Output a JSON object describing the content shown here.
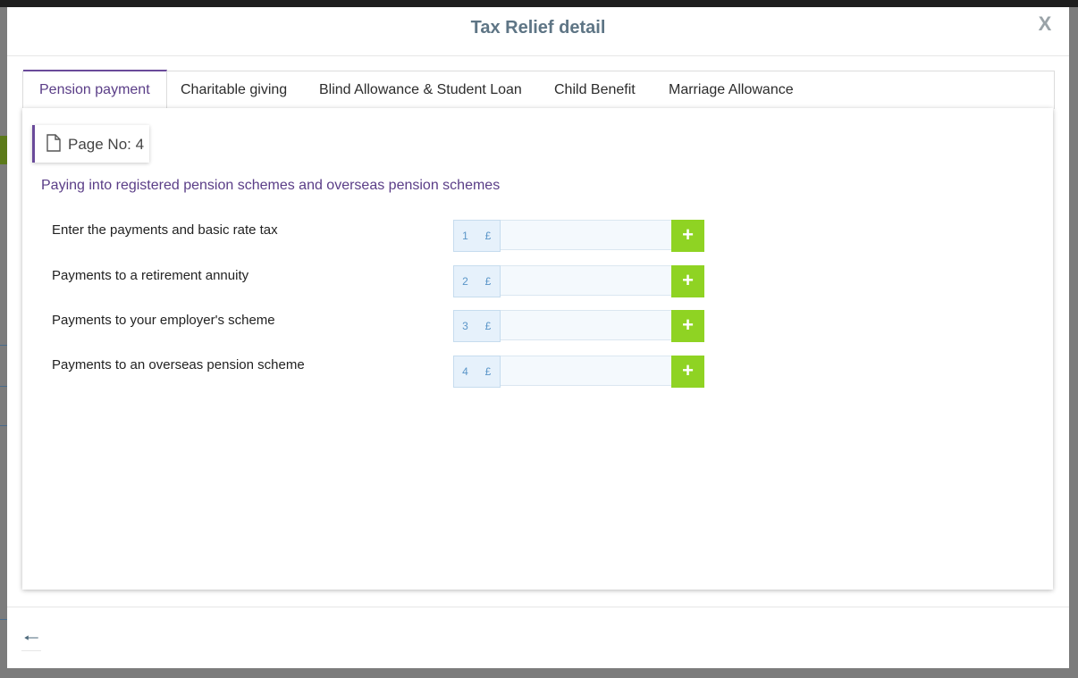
{
  "modal": {
    "title": "Tax Relief detail",
    "close_label": "X",
    "back_icon": "arrow-left-icon"
  },
  "tabs": [
    {
      "label": "Pension payment",
      "active": true
    },
    {
      "label": "Charitable giving",
      "active": false
    },
    {
      "label": "Blind Allowance & Student Loan",
      "active": false
    },
    {
      "label": "Child Benefit",
      "active": false
    },
    {
      "label": "Marriage Allowance",
      "active": false
    }
  ],
  "page_badge": {
    "label": "Page No: 4",
    "icon": "document-icon"
  },
  "section": {
    "title": "Paying into registered pension schemes and overseas pension schemes"
  },
  "fields": [
    {
      "label": "Enter the payments and basic rate tax",
      "number": "1",
      "currency": "£",
      "value": ""
    },
    {
      "label": "Payments to a retirement annuity",
      "number": "2",
      "currency": "£",
      "value": ""
    },
    {
      "label": "Payments to your employer's scheme",
      "number": "3",
      "currency": "£",
      "value": ""
    },
    {
      "label": "Payments to an overseas pension scheme",
      "number": "4",
      "currency": "£",
      "value": ""
    }
  ],
  "add_button_symbol": "+",
  "colors": {
    "accent_purple": "#5a3d87",
    "add_green": "#8fd323",
    "title_slate": "#5e7585"
  }
}
